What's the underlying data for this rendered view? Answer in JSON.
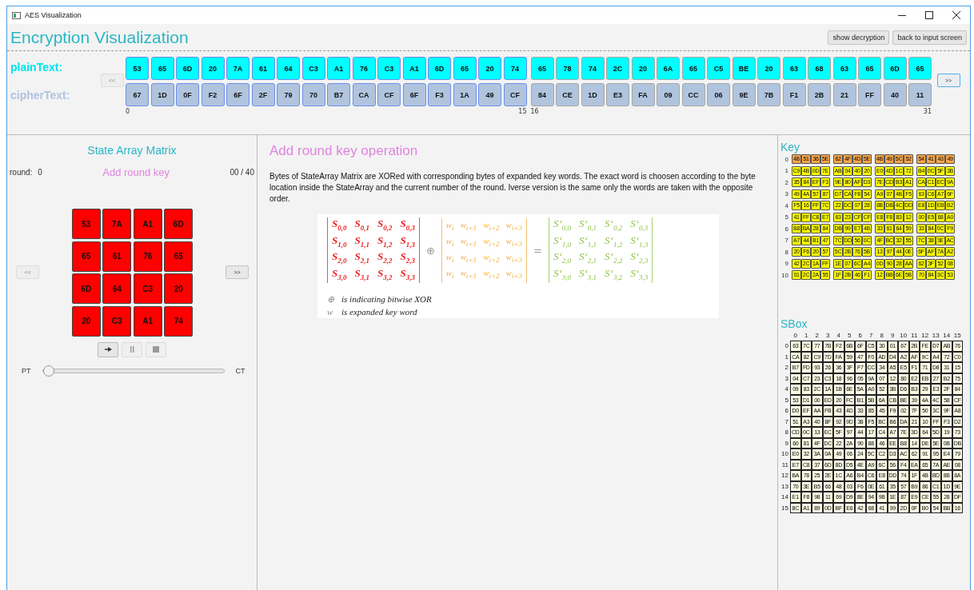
{
  "window": {
    "title": "AES Visualization"
  },
  "header": {
    "title": "Encryption Visualization",
    "buttons": [
      {
        "label": "show decryption"
      },
      {
        "label": "back to input screen"
      }
    ]
  },
  "bytes": {
    "prev": {
      "label": "<<",
      "disabled": true
    },
    "next": {
      "label": ">>",
      "disabled": false
    },
    "rows": [
      {
        "label": "plainText:",
        "kind": "plain",
        "blocks": [
          {
            "selected": true,
            "cells": [
              "53",
              "65",
              "6D",
              "20",
              "7A",
              "61",
              "64",
              "C3",
              "A1",
              "76",
              "C3",
              "A1",
              "6D",
              "65",
              "20",
              "74"
            ]
          },
          {
            "selected": false,
            "cells": [
              "65",
              "78",
              "74",
              "2C",
              "20",
              "6A",
              "65",
              "C5",
              "BE",
              "20",
              "63",
              "68",
              "63",
              "65",
              "6D",
              "65"
            ]
          }
        ]
      },
      {
        "label": "cipherText:",
        "kind": "cipher",
        "blocks": [
          {
            "selected": true,
            "cells": [
              "67",
              "1D",
              "0F",
              "F2",
              "6F",
              "2F",
              "79",
              "70",
              "B7",
              "CA",
              "CF",
              "6F",
              "F3",
              "1A",
              "49",
              "CF"
            ]
          },
          {
            "selected": false,
            "cells": [
              "84",
              "CE",
              "1D",
              "E3",
              "FA",
              "09",
              "CC",
              "06",
              "9E",
              "7B",
              "F1",
              "2B",
              "21",
              "FF",
              "40",
              "11"
            ]
          }
        ]
      }
    ],
    "indices": [
      {
        "start": "0",
        "end": "15"
      },
      {
        "start": "16",
        "end": "31"
      }
    ]
  },
  "state": {
    "title": "State Array Matrix",
    "round_label": "round:",
    "round": "0",
    "step": "Add round key",
    "progress": "00 / 40",
    "prev": {
      "label": "<<",
      "disabled": true
    },
    "next": {
      "label": ">>",
      "disabled": false
    },
    "matrix": [
      [
        "53",
        "7A",
        "A1",
        "6D"
      ],
      [
        "65",
        "61",
        "76",
        "65"
      ],
      [
        "6D",
        "64",
        "C3",
        "20"
      ],
      [
        "20",
        "C3",
        "A1",
        "74"
      ]
    ],
    "controls": [
      {
        "kind": "play",
        "disabled": false
      },
      {
        "kind": "pause",
        "disabled": true
      },
      {
        "kind": "stop",
        "disabled": true
      }
    ],
    "slider": {
      "start_label": "PT",
      "end_label": "CT",
      "level": 0
    }
  },
  "operation": {
    "title": "Add round key operation",
    "description": "Bytes of StateArray Matrix are XORed with corresponding bytes of expanded key words. The exact word is choosen according to the byte location inside the StateArray and the current number of the round. Iverse version is the same only the words are taken with the opposite order.",
    "formula": {
      "terms": [
        {
          "kind": "state_matrix",
          "rows": [
            [
              "S$_{0,0}$",
              "S$_{0,1}$",
              "S$_{0,2}$",
              "S$_{0,3}$"
            ],
            [
              "S$_{1,0}$",
              "S$_{1,1}$",
              "S$_{1,2}$",
              "S$_{1,3}$"
            ],
            [
              "S$_{2,0}$",
              "S$_{2,1}$",
              "S$_{2,2}$",
              "S$_{2,3}$"
            ],
            [
              "S$_{3,0}$",
              "S$_{3,1}$",
              "S$_{3,2}$",
              "S$_{3,3}$"
            ]
          ]
        },
        {
          "kind": "operator",
          "text": "⊕"
        },
        {
          "kind": "key_matrix",
          "rows": [
            [
              "w$_{i}$",
              "w$_{i+1}$",
              "w$_{i+2}$",
              "w$_{i+3}$"
            ],
            [
              "w$_{i}$",
              "w$_{i+1}$",
              "w$_{i+2}$",
              "w$_{i+3}$"
            ],
            [
              "w$_{i}$",
              "w$_{i+1}$",
              "w$_{i+2}$",
              "w$_{i+3}$"
            ],
            [
              "w$_{i}$",
              "w$_{i+1}$",
              "w$_{i+2}$",
              "w$_{i+3}$"
            ]
          ]
        },
        {
          "kind": "operator",
          "text": "="
        },
        {
          "kind": "result_matrix",
          "rows": [
            [
              "S‘$_{0,0}$",
              "S‘$_{0,1}$",
              "S‘$_{0,2}$",
              "S‘$_{0,3}$"
            ],
            [
              "S‘$_{1,0}$",
              "S‘$_{1,1}$",
              "S‘$_{1,2}$",
              "S‘$_{1,3}$"
            ],
            [
              "S‘$_{2,0}$",
              "S‘$_{2,1}$",
              "S‘$_{2,2}$",
              "S‘$_{2,3}$"
            ],
            [
              "S‘$_{3,0}$",
              "S‘$_{3,1}$",
              "S‘$_{3,2}$",
              "S‘$_{3,3}$"
            ]
          ]
        }
      ],
      "legend": [
        {
          "symbol": "⊕",
          "text": "is indicating bitwise XOR"
        },
        {
          "symbol": "w",
          "text": "is expanded key word"
        }
      ]
    }
  },
  "key": {
    "title": "Key",
    "rows": [
      {
        "label": "0",
        "selected": true,
        "words": [
          [
            "4B",
            "51",
            "36",
            "5E"
          ],
          [
            "62",
            "4F",
            "4D",
            "5E"
          ],
          [
            "4B",
            "49",
            "5C",
            "52"
          ],
          [
            "54",
            "41",
            "43",
            "49"
          ]
        ]
      },
      {
        "label": "1",
        "selected": false,
        "words": [
          [
            "C9",
            "4B",
            "0D",
            "7E"
          ],
          [
            "AB",
            "04",
            "40",
            "20"
          ],
          [
            "E0",
            "4D",
            "1C",
            "72"
          ],
          [
            "B4",
            "0C",
            "5F",
            "3B"
          ]
        ]
      },
      {
        "label": "2",
        "selected": false,
        "words": [
          [
            "35",
            "84",
            "EF",
            "F3"
          ],
          [
            "9E",
            "80",
            "AF",
            "D3"
          ],
          [
            "7E",
            "CD",
            "B3",
            "A1"
          ],
          [
            "CA",
            "C1",
            "EC",
            "9A"
          ]
        ]
      },
      {
        "label": "3",
        "selected": false,
        "words": [
          [
            "49",
            "4A",
            "57",
            "87"
          ],
          [
            "D7",
            "CA",
            "F8",
            "54"
          ],
          [
            "A9",
            "07",
            "4B",
            "F5"
          ],
          [
            "63",
            "C6",
            "A7",
            "6F"
          ]
        ]
      },
      {
        "label": "4",
        "selected": false,
        "words": [
          [
            "F5",
            "16",
            "FF",
            "7C"
          ],
          [
            "22",
            "DC",
            "07",
            "28"
          ],
          [
            "8B",
            "DB",
            "4C",
            "DD"
          ],
          [
            "E8",
            "1D",
            "EB",
            "B2"
          ]
        ]
      },
      {
        "label": "5",
        "selected": false,
        "words": [
          [
            "41",
            "FF",
            "C8",
            "E7"
          ],
          [
            "63",
            "23",
            "CF",
            "CF"
          ],
          [
            "E8",
            "F8",
            "83",
            "12"
          ],
          [
            "00",
            "E5",
            "68",
            "A0"
          ]
        ]
      },
      {
        "label": "6",
        "selected": false,
        "words": [
          [
            "B8",
            "BA",
            "28",
            "84"
          ],
          [
            "DB",
            "99",
            "E7",
            "4B"
          ],
          [
            "33",
            "61",
            "64",
            "59"
          ],
          [
            "33",
            "84",
            "0C",
            "F9"
          ]
        ]
      },
      {
        "label": "7",
        "selected": false,
        "words": [
          [
            "A7",
            "44",
            "B1",
            "47"
          ],
          [
            "7C",
            "DD",
            "56",
            "0C"
          ],
          [
            "4F",
            "BC",
            "32",
            "55"
          ],
          [
            "7C",
            "38",
            "3E",
            "AC"
          ]
        ]
      },
      {
        "label": "8",
        "selected": false,
        "words": [
          [
            "20",
            "F6",
            "20",
            "57"
          ],
          [
            "5C",
            "2B",
            "76",
            "5B"
          ],
          [
            "13",
            "97",
            "44",
            "0E"
          ],
          [
            "6F",
            "AF",
            "7A",
            "A2"
          ]
        ]
      },
      {
        "label": "9",
        "selected": false,
        "words": [
          [
            "42",
            "2C",
            "1A",
            "FF"
          ],
          [
            "1E",
            "07",
            "6C",
            "A4"
          ],
          [
            "0D",
            "90",
            "28",
            "AA"
          ],
          [
            "62",
            "3F",
            "52",
            "08"
          ]
        ]
      },
      {
        "label": "10",
        "selected": false,
        "words": [
          [
            "01",
            "2C",
            "2A",
            "55"
          ],
          [
            "1F",
            "2B",
            "46",
            "F1"
          ],
          [
            "12",
            "BB",
            "6E",
            "5B"
          ],
          [
            "70",
            "84",
            "3C",
            "53"
          ]
        ]
      }
    ]
  },
  "sbox": {
    "title": "SBox",
    "columns": [
      "0",
      "1",
      "2",
      "3",
      "4",
      "5",
      "6",
      "7",
      "8",
      "9",
      "10",
      "11",
      "12",
      "13",
      "14",
      "15"
    ],
    "rows": [
      {
        "label": "0",
        "cells": [
          "63",
          "7C",
          "77",
          "7B",
          "F2",
          "6B",
          "6F",
          "C5",
          "30",
          "01",
          "67",
          "2B",
          "FE",
          "D7",
          "AB",
          "76"
        ]
      },
      {
        "label": "1",
        "cells": [
          "CA",
          "82",
          "C9",
          "7D",
          "FA",
          "59",
          "47",
          "F0",
          "AD",
          "D4",
          "A2",
          "AF",
          "9C",
          "A4",
          "72",
          "C0"
        ]
      },
      {
        "label": "2",
        "cells": [
          "B7",
          "FD",
          "93",
          "26",
          "36",
          "3F",
          "F7",
          "CC",
          "34",
          "A5",
          "E5",
          "F1",
          "71",
          "D8",
          "31",
          "15"
        ]
      },
      {
        "label": "3",
        "cells": [
          "04",
          "C7",
          "23",
          "C3",
          "18",
          "96",
          "05",
          "9A",
          "07",
          "12",
          "80",
          "E2",
          "EB",
          "27",
          "B2",
          "75"
        ]
      },
      {
        "label": "4",
        "cells": [
          "09",
          "83",
          "2C",
          "1A",
          "1B",
          "6E",
          "5A",
          "A0",
          "52",
          "3B",
          "D6",
          "B3",
          "29",
          "E3",
          "2F",
          "84"
        ]
      },
      {
        "label": "5",
        "cells": [
          "53",
          "D1",
          "00",
          "ED",
          "20",
          "FC",
          "B1",
          "5B",
          "6A",
          "CB",
          "BE",
          "39",
          "4A",
          "4C",
          "58",
          "CF"
        ]
      },
      {
        "label": "6",
        "cells": [
          "D0",
          "EF",
          "AA",
          "FB",
          "43",
          "4D",
          "33",
          "85",
          "45",
          "F9",
          "02",
          "7F",
          "50",
          "3C",
          "9F",
          "A8"
        ]
      },
      {
        "label": "7",
        "cells": [
          "51",
          "A3",
          "40",
          "8F",
          "92",
          "9D",
          "38",
          "F5",
          "BC",
          "B6",
          "DA",
          "21",
          "10",
          "FF",
          "F3",
          "D2"
        ]
      },
      {
        "label": "8",
        "cells": [
          "CD",
          "0C",
          "13",
          "EC",
          "5F",
          "97",
          "44",
          "17",
          "C4",
          "A7",
          "7E",
          "3D",
          "64",
          "5D",
          "19",
          "73"
        ]
      },
      {
        "label": "9",
        "cells": [
          "60",
          "81",
          "4F",
          "DC",
          "22",
          "2A",
          "90",
          "88",
          "46",
          "EE",
          "B8",
          "14",
          "DE",
          "5E",
          "0B",
          "DB"
        ]
      },
      {
        "label": "10",
        "cells": [
          "E0",
          "32",
          "3A",
          "0A",
          "49",
          "06",
          "24",
          "5C",
          "C2",
          "D3",
          "AC",
          "62",
          "91",
          "95",
          "E4",
          "79"
        ]
      },
      {
        "label": "11",
        "cells": [
          "E7",
          "C8",
          "37",
          "6D",
          "8D",
          "D5",
          "4E",
          "A9",
          "6C",
          "56",
          "F4",
          "EA",
          "65",
          "7A",
          "AE",
          "08"
        ]
      },
      {
        "label": "12",
        "cells": [
          "BA",
          "78",
          "25",
          "2E",
          "1C",
          "A6",
          "B4",
          "C6",
          "E8",
          "DD",
          "74",
          "1F",
          "4B",
          "BD",
          "8B",
          "8A"
        ]
      },
      {
        "label": "13",
        "cells": [
          "70",
          "3E",
          "B5",
          "66",
          "48",
          "03",
          "F6",
          "0E",
          "61",
          "35",
          "57",
          "B9",
          "86",
          "C1",
          "1D",
          "9E"
        ]
      },
      {
        "label": "14",
        "cells": [
          "E1",
          "F8",
          "98",
          "11",
          "69",
          "D9",
          "8E",
          "94",
          "9B",
          "1E",
          "87",
          "E9",
          "CE",
          "55",
          "28",
          "DF"
        ]
      },
      {
        "label": "15",
        "cells": [
          "8C",
          "A1",
          "89",
          "0D",
          "BF",
          "E6",
          "42",
          "68",
          "41",
          "99",
          "2D",
          "0F",
          "B0",
          "54",
          "BB",
          "16"
        ]
      }
    ]
  }
}
